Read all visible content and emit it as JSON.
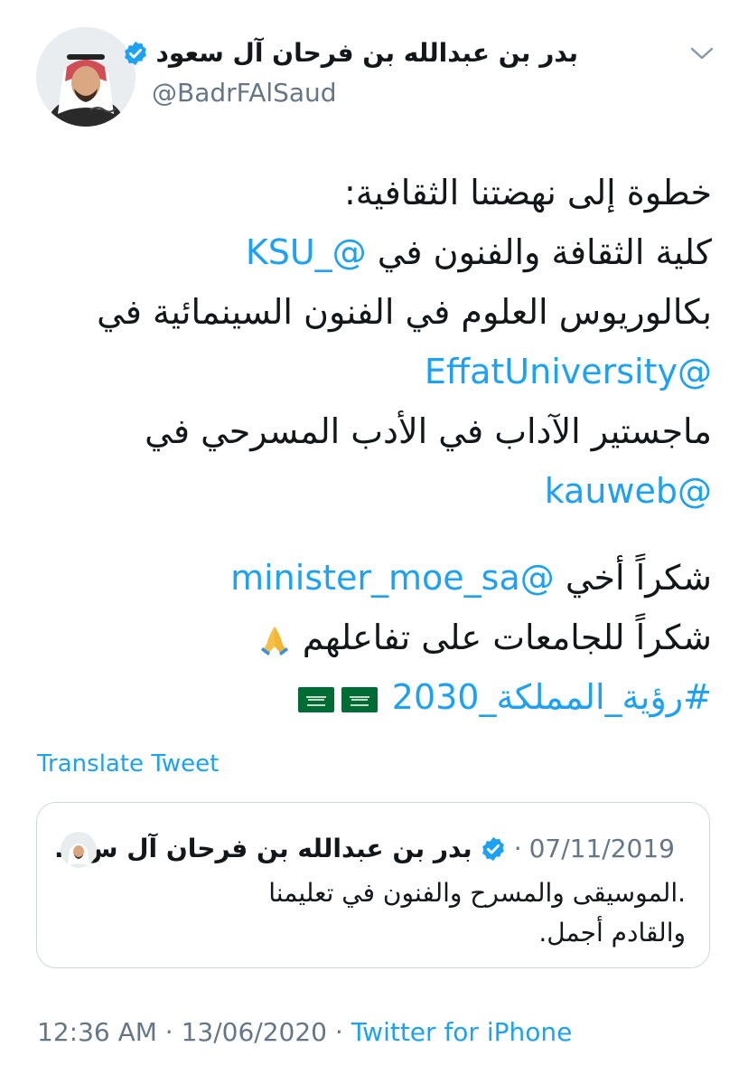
{
  "author": {
    "name": "بدر بن عبدالله بن فرحان آل سعود",
    "handle": "@BadrFAlSaud"
  },
  "tweet": {
    "line1": "خطوة إلى نهضتنا الثقافية:",
    "line2_text": "كلية الثقافة والفنون في ",
    "line2_mention": "@_KSU",
    "line3": "بكالوريوس العلوم في الفنون السينمائية في",
    "line4_mention": "@EffatUniversity",
    "line5": "ماجستير الآداب في الأدب المسرحي في",
    "line6_mention": "@kauweb",
    "line7_text": "شكراً أخي ",
    "line7_mention": "@minister_moe_sa",
    "line8_text": "شكراً للجامعات على تفاعلهم",
    "line9_hashtag": "#رؤية_المملكة_2030"
  },
  "translate_label": "Translate Tweet",
  "quote": {
    "name": "بدر بن عبدالله بن فرحان آل س...",
    "sep": "·",
    "date": "07/11/2019",
    "line1": ".الموسيقى والمسرح والفنون في تعليمنا",
    "line2": "والقادم أجمل."
  },
  "footer": {
    "time": "12:36 AM · 13/06/2020 · ",
    "source": "Twitter for iPhone"
  },
  "colors": {
    "link": "#1da1f2",
    "muted": "#657786",
    "border": "#ccd6dd",
    "flag_green": "#006c35"
  },
  "icons": [
    "verified-badge-icon",
    "chevron-down-icon",
    "folded-hands-emoji",
    "saudi-flag-emoji"
  ]
}
